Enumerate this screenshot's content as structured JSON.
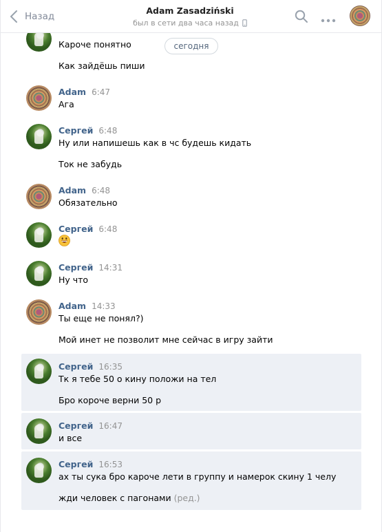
{
  "header": {
    "back_label": "Назад",
    "contact_name": "Adam Zasadziński",
    "status": "был в сети два часа назад"
  },
  "date_divider": "сегодня",
  "messages": [
    {
      "author": "",
      "time": "",
      "lines": [
        "Кароче понятно",
        "Как зайдёшь пиши"
      ]
    },
    {
      "author": "Adam",
      "time": "6:47",
      "lines": [
        "Ага"
      ]
    },
    {
      "author": "Сергей",
      "time": "6:48",
      "lines": [
        "Ну или напишешь как в чс будешь кидать",
        "Ток не забудь"
      ]
    },
    {
      "author": "Adam",
      "time": "6:48",
      "lines": [
        "Обязательно"
      ]
    },
    {
      "author": "Сергей",
      "time": "6:48",
      "lines": []
    },
    {
      "author": "Сергей",
      "time": "14:31",
      "lines": [
        "Ну что"
      ]
    },
    {
      "author": "Adam",
      "time": "14:33",
      "lines": [
        "Ты еще не понял?)",
        "Мой инет не позволит мне сейчас в игру зайти"
      ]
    },
    {
      "author": "Сергей",
      "time": "16:35",
      "lines": [
        "Тк я тебе 50 о кину положи на тел",
        "Бро короче верни 50 р"
      ]
    },
    {
      "author": "Сергей",
      "time": "16:47",
      "lines": [
        "и все"
      ]
    },
    {
      "author": "Сергей",
      "time": "16:53",
      "lines": [
        "ах ты сука бро кароче лети в группу и намерок скину 1 челу",
        "жди человек с пагонами"
      ],
      "edited": "(ред.)"
    }
  ]
}
